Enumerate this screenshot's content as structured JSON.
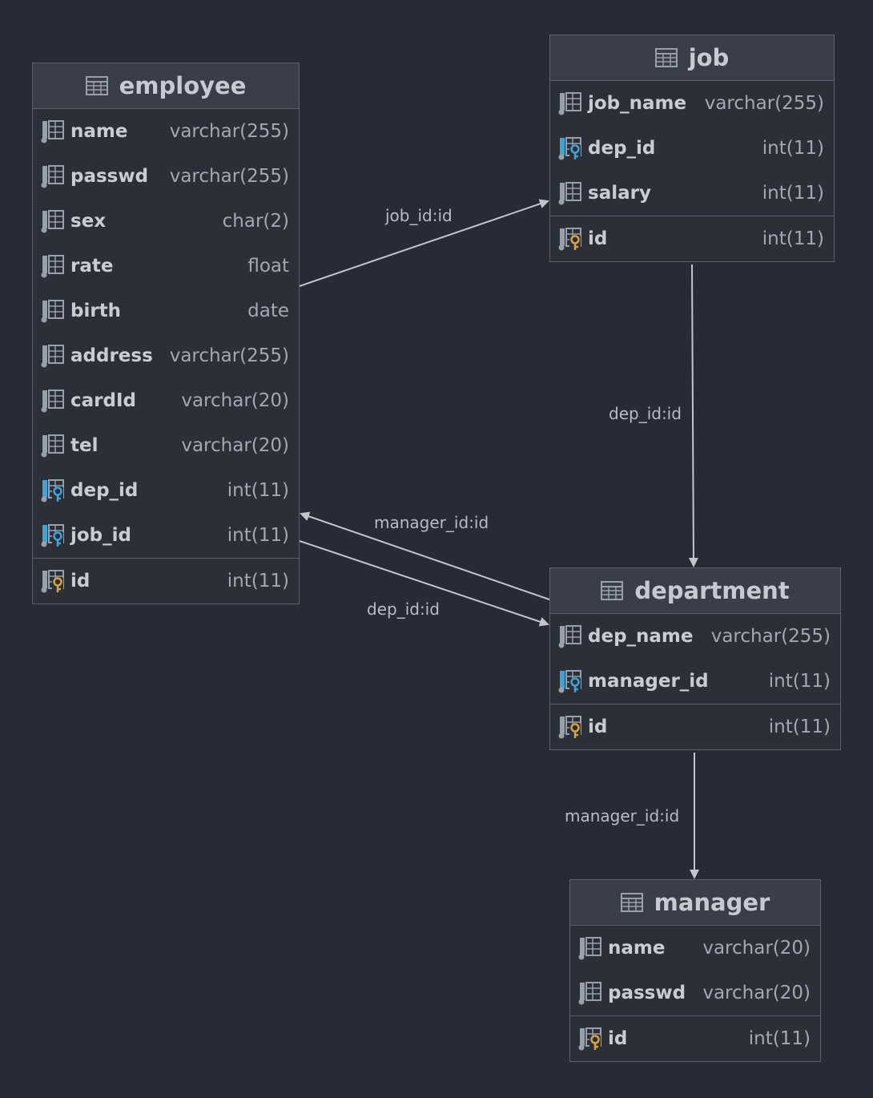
{
  "tables": {
    "employee": {
      "title": "employee",
      "columns": [
        {
          "name": "name",
          "type": "varchar(255)",
          "kind": "column"
        },
        {
          "name": "passwd",
          "type": "varchar(255)",
          "kind": "column"
        },
        {
          "name": "sex",
          "type": "char(2)",
          "kind": "column"
        },
        {
          "name": "rate",
          "type": "float",
          "kind": "column"
        },
        {
          "name": "birth",
          "type": "date",
          "kind": "column"
        },
        {
          "name": "address",
          "type": "varchar(255)",
          "kind": "column"
        },
        {
          "name": "cardId",
          "type": "varchar(20)",
          "kind": "column"
        },
        {
          "name": "tel",
          "type": "varchar(20)",
          "kind": "column"
        },
        {
          "name": "dep_id",
          "type": "int(11)",
          "kind": "foreign-key"
        },
        {
          "name": "job_id",
          "type": "int(11)",
          "kind": "foreign-key"
        }
      ],
      "pk": {
        "name": "id",
        "type": "int(11)",
        "kind": "primary-key"
      }
    },
    "job": {
      "title": "job",
      "columns": [
        {
          "name": "job_name",
          "type": "varchar(255)",
          "kind": "column"
        },
        {
          "name": "dep_id",
          "type": "int(11)",
          "kind": "foreign-key"
        },
        {
          "name": "salary",
          "type": "int(11)",
          "kind": "column"
        }
      ],
      "pk": {
        "name": "id",
        "type": "int(11)",
        "kind": "primary-key"
      }
    },
    "department": {
      "title": "department",
      "columns": [
        {
          "name": "dep_name",
          "type": "varchar(255)",
          "kind": "column"
        },
        {
          "name": "manager_id",
          "type": "int(11)",
          "kind": "foreign-key"
        }
      ],
      "pk": {
        "name": "id",
        "type": "int(11)",
        "kind": "primary-key"
      }
    },
    "manager": {
      "title": "manager",
      "columns": [
        {
          "name": "name",
          "type": "varchar(20)",
          "kind": "column"
        },
        {
          "name": "passwd",
          "type": "varchar(20)",
          "kind": "column"
        }
      ],
      "pk": {
        "name": "id",
        "type": "int(11)",
        "kind": "primary-key"
      }
    }
  },
  "relationships": [
    {
      "id": "employee-job",
      "label": "job_id:id"
    },
    {
      "id": "job-department",
      "label": "dep_id:id"
    },
    {
      "id": "department-employee",
      "label": "manager_id:id"
    },
    {
      "id": "employee-department",
      "label": "dep_id:id"
    },
    {
      "id": "department-manager",
      "label": "manager_id:id"
    }
  ],
  "colors": {
    "background": "#272b35",
    "edge": "#c2c5cc",
    "fk_key": "#3fa3d8",
    "pk_key": "#d9a23a",
    "column_bar_accent": "#3fa3d8"
  }
}
